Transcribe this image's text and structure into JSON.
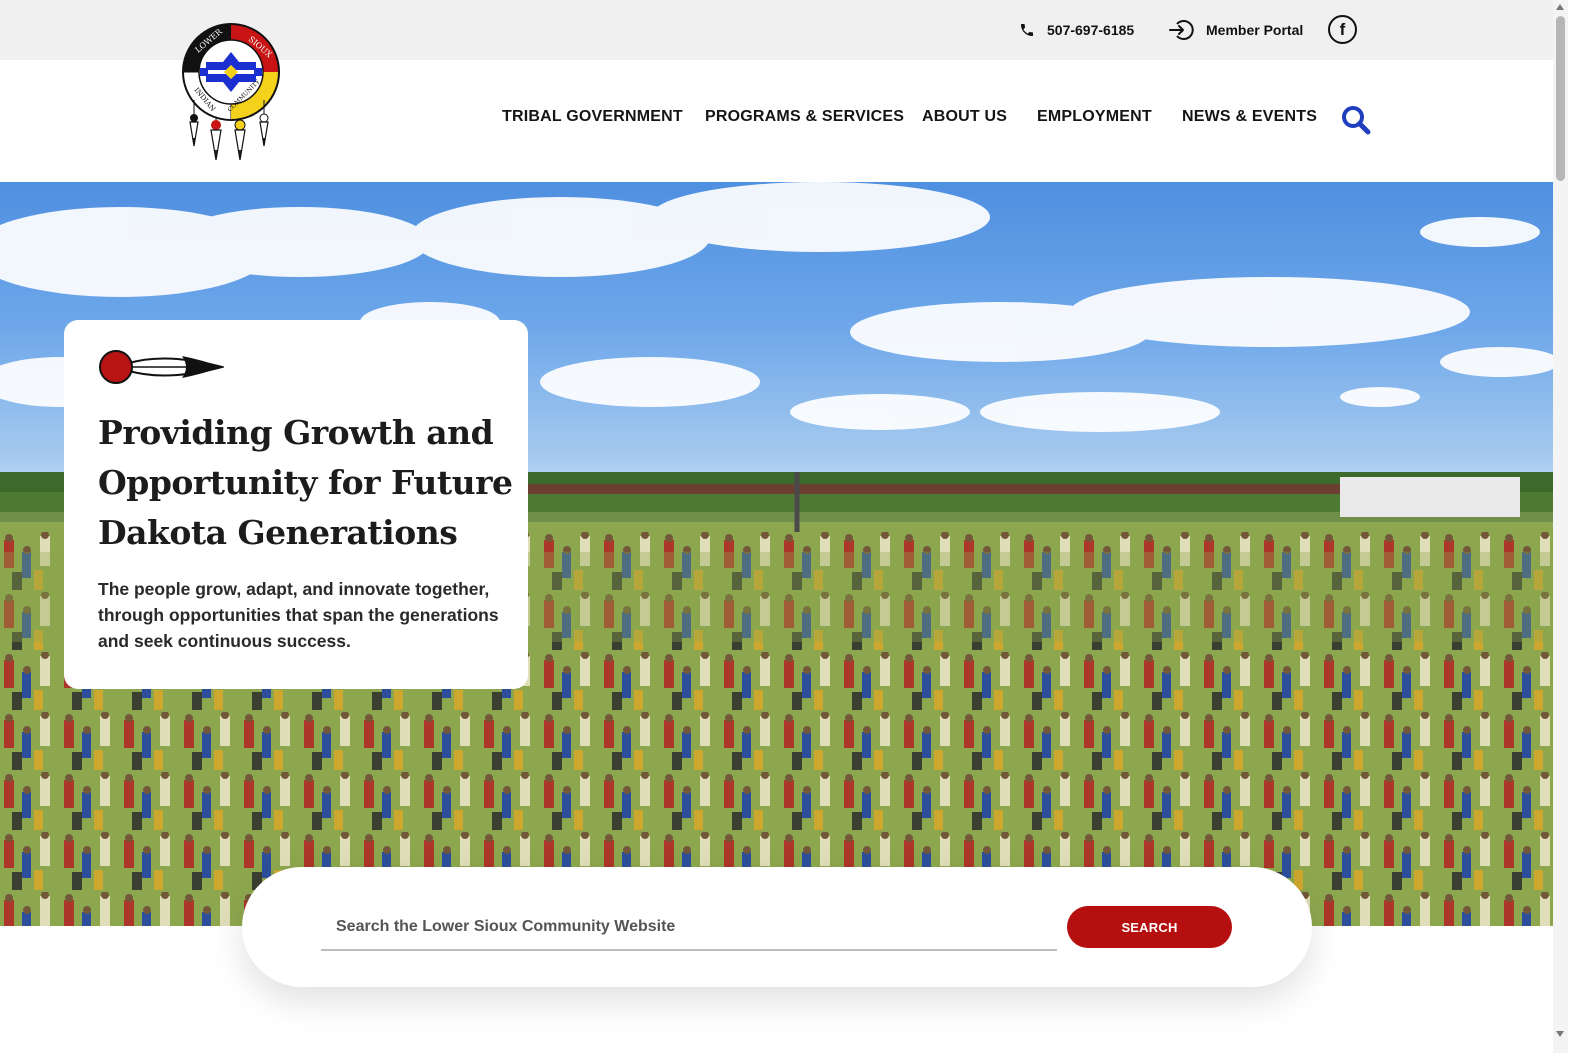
{
  "topbar": {
    "phone": {
      "icon": "phone-icon",
      "label": "507-697-6185"
    },
    "portal": {
      "icon": "sign-in-icon",
      "label": "Member Portal"
    },
    "social": {
      "icon": "facebook-icon",
      "glyph": "f"
    }
  },
  "logo": {
    "icon": "lower-sioux-indian-community-seal",
    "text_top_left": "LOWER",
    "text_top_right": "SIOUX",
    "text_bottom_left": "INDIAN",
    "text_bottom_right": "COMMUNITY"
  },
  "nav": {
    "items": [
      {
        "label": "TRIBAL GOVERNMENT"
      },
      {
        "label": "PROGRAMS & SERVICES"
      },
      {
        "label": "ABOUT US"
      },
      {
        "label": "EMPLOYMENT"
      },
      {
        "label": "NEWS & EVENTS"
      }
    ],
    "search_icon": "search-icon"
  },
  "hero": {
    "image": "powwow-grand-entry-photo",
    "card": {
      "feather_icon": "feather-icon",
      "headline": "Providing Growth and Opportunity for Future Dakota Generations",
      "subtext": "The people grow, adapt, and innovate together, through opportunities that span the generations and seek continuous success."
    }
  },
  "search": {
    "placeholder": "Search the Lower Sioux Community Website",
    "button_label": "SEARCH"
  },
  "colors": {
    "accent_red": "#b50f0f",
    "nav_search_blue": "#1f3fbf",
    "topbar_bg": "#f0f0f0"
  }
}
